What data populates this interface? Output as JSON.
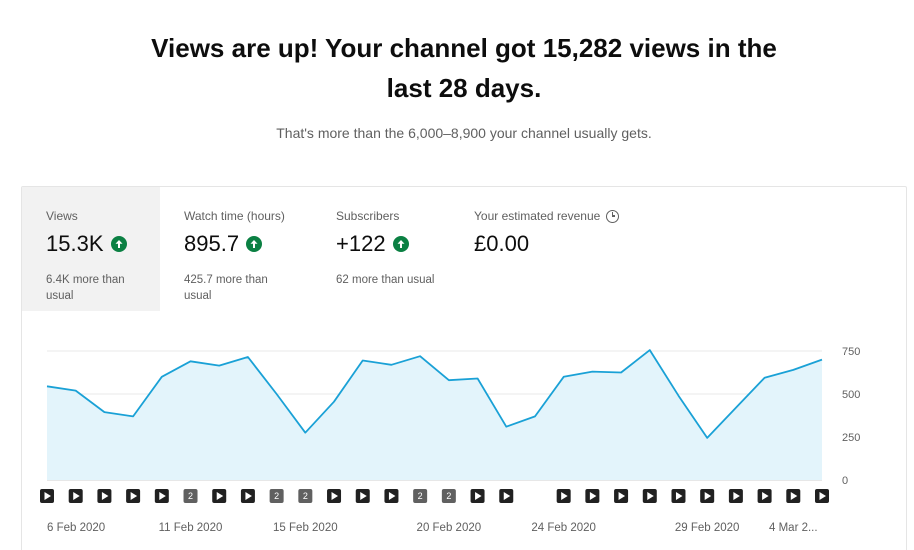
{
  "headline": {
    "line1": "Views are up! Your channel got 15,282 views in the",
    "line2": "last 28 days."
  },
  "subline": "That's more than the 6,000–8,900 your channel usually gets.",
  "metrics": [
    {
      "label": "Views",
      "value": "15.3K",
      "note": "6.4K more than usual",
      "trend": "up"
    },
    {
      "label": "Watch time (hours)",
      "value": "895.7",
      "note": "425.7 more than usual",
      "trend": "up"
    },
    {
      "label": "Subscribers",
      "value": "+122",
      "note": "62 more than usual",
      "trend": "up"
    },
    {
      "label": "Your estimated revenue",
      "value": "£0.00",
      "note": "",
      "trend": "none"
    }
  ],
  "colors": {
    "line": "#1aa1d6",
    "fill": "#e3f4fb",
    "up": "#0b8043",
    "marker": "#3d3d3d"
  },
  "chart_data": {
    "type": "area",
    "ylim": [
      0,
      750
    ],
    "yticks": [
      0,
      250,
      500,
      750
    ],
    "x": [
      "6 Feb 2020",
      "7 Feb 2020",
      "8 Feb 2020",
      "9 Feb 2020",
      "10 Feb 2020",
      "11 Feb 2020",
      "12 Feb 2020",
      "13 Feb 2020",
      "14 Feb 2020",
      "15 Feb 2020",
      "16 Feb 2020",
      "17 Feb 2020",
      "18 Feb 2020",
      "19 Feb 2020",
      "20 Feb 2020",
      "21 Feb 2020",
      "22 Feb 2020",
      "23 Feb 2020",
      "24 Feb 2020",
      "25 Feb 2020",
      "26 Feb 2020",
      "27 Feb 2020",
      "28 Feb 2020",
      "29 Feb 2020",
      "1 Mar 2020",
      "2 Mar 2020",
      "3 Mar 2020",
      "4 Mar 2020"
    ],
    "values": [
      545,
      520,
      395,
      370,
      600,
      690,
      665,
      715,
      500,
      275,
      455,
      695,
      670,
      720,
      580,
      590,
      310,
      370,
      600,
      630,
      625,
      755,
      490,
      245,
      420,
      595,
      640,
      700
    ],
    "xtick_labels": [
      {
        "index": 0,
        "label": "6 Feb 2020"
      },
      {
        "index": 5,
        "label": "11 Feb 2020"
      },
      {
        "index": 9,
        "label": "15 Feb 2020"
      },
      {
        "index": 14,
        "label": "20 Feb 2020"
      },
      {
        "index": 18,
        "label": "24 Feb 2020"
      },
      {
        "index": 23,
        "label": "29 Feb 2020"
      },
      {
        "index": 26,
        "label": "4 Mar 2..."
      }
    ],
    "video_markers": [
      "play",
      "play",
      "play",
      "play",
      "play",
      "2",
      "play",
      "play",
      "2",
      "2",
      "play",
      "play",
      "play",
      "2",
      "2",
      "play",
      "play",
      "",
      "play",
      "play",
      "play",
      "play",
      "play",
      "play",
      "play",
      "play",
      "play",
      "play"
    ]
  }
}
